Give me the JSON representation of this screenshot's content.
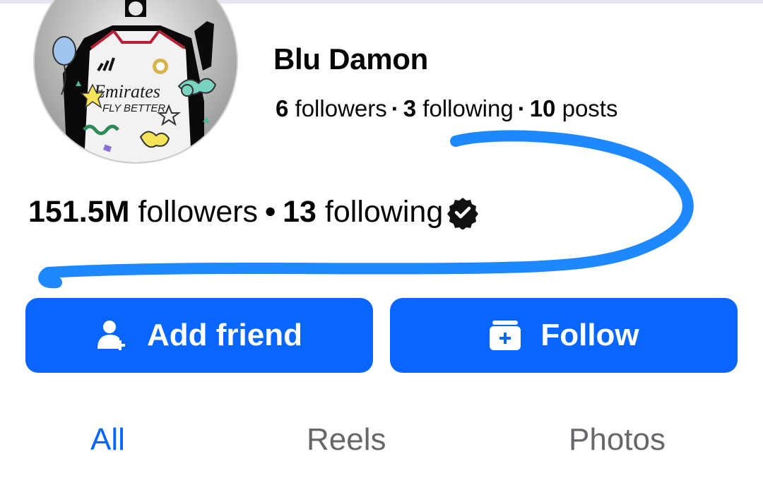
{
  "profile": {
    "name": "Blu Damon",
    "mini_stats": {
      "followers_count": "6",
      "followers_label": "followers",
      "following_count": "3",
      "following_label": "following",
      "posts_count": "10",
      "posts_label": "posts",
      "separator": "·"
    },
    "page_stats": {
      "followers_count": "151.5M",
      "followers_label": "followers",
      "separator": "•",
      "following_count": "13",
      "following_label": "following"
    },
    "avatar": {
      "jersey_sponsor": "Emirates",
      "jersey_slogan": "FLY BETTER"
    }
  },
  "actions": {
    "add_friend_label": "Add friend",
    "follow_label": "Follow"
  },
  "tabs": [
    {
      "label": "All",
      "active": true
    },
    {
      "label": "Reels",
      "active": false
    },
    {
      "label": "Photos",
      "active": false
    }
  ],
  "colors": {
    "accent": "#0866ff",
    "scribble": "#1e88ff",
    "inactive_tab": "#65676b"
  },
  "icons": {
    "verified": "verified-badge-icon",
    "add_friend": "person-add-icon",
    "follow": "follow-box-icon"
  }
}
